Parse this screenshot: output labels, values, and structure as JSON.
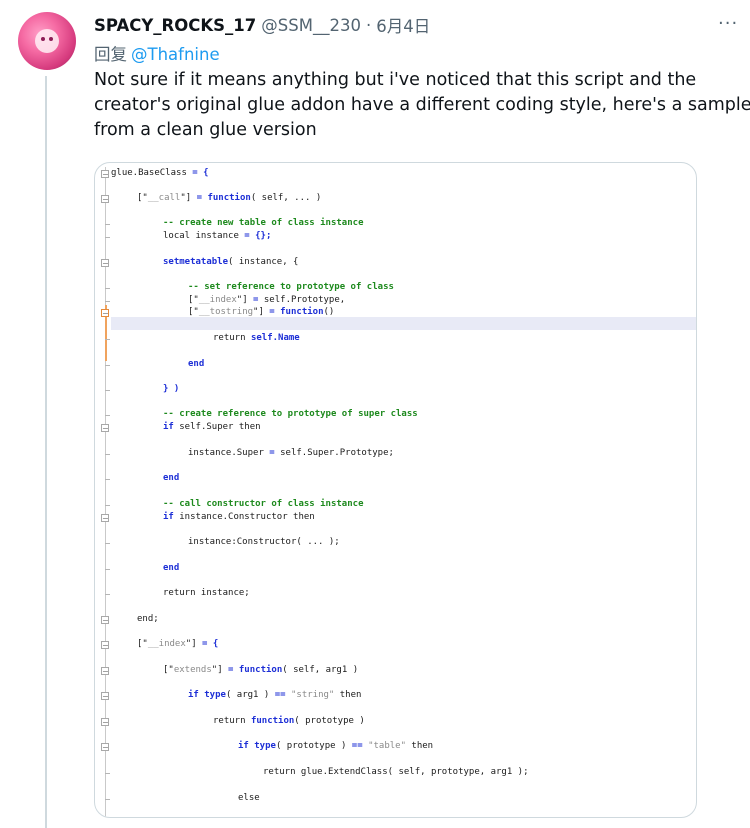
{
  "tweet": {
    "display_name": "SPACY_ROCKS_17",
    "handle": "@SSM__230",
    "separator": "·",
    "date": "6月4日",
    "more": "···",
    "reply_prefix": "回复",
    "reply_to": "@Thafnine",
    "text_lines": [
      "Not sure if it means anything but i've noticed that this script and the",
      "creator's original glue addon have a different coding style, here's a sample",
      "from a clean glue version"
    ]
  },
  "code_lines": [
    {
      "indent": 0,
      "parts": [
        [
          "t",
          "glue.BaseClass "
        ],
        [
          "o",
          "= {"
        ]
      ]
    },
    {
      "indent": 1,
      "parts": [
        [
          "t",
          "[\""
        ],
        [
          "s",
          "__call"
        ],
        [
          "t",
          "\"] "
        ],
        [
          "o",
          "= "
        ],
        [
          "k",
          "function"
        ],
        [
          "t",
          "( self, ... )"
        ]
      ]
    },
    {
      "indent": 2,
      "parts": [
        [
          "c",
          "-- create new table of class instance"
        ]
      ]
    },
    {
      "indent": 2,
      "parts": [
        [
          "t",
          "local instance "
        ],
        [
          "o",
          "= {};"
        ]
      ]
    },
    {
      "indent": 2,
      "parts": [
        [
          "k",
          "setmetatable"
        ],
        [
          "t",
          "( instance, {"
        ]
      ]
    },
    {
      "indent": 3,
      "parts": [
        [
          "c",
          "-- set reference to prototype of class"
        ]
      ]
    },
    {
      "indent": 3,
      "parts": [
        [
          "t",
          "[\""
        ],
        [
          "s",
          "__index"
        ],
        [
          "t",
          "\"] "
        ],
        [
          "o",
          "= "
        ],
        [
          "t",
          "self.Prototype,"
        ]
      ]
    },
    {
      "indent": 3,
      "parts": [
        [
          "t",
          "[\""
        ],
        [
          "s",
          "__tostring"
        ],
        [
          "t",
          "\"] "
        ],
        [
          "o",
          "= "
        ],
        [
          "k",
          "function"
        ],
        [
          "t",
          "()"
        ]
      ]
    },
    {
      "indent": 4,
      "parts": [
        [
          "t",
          "return "
        ],
        [
          "k",
          "self.Name"
        ]
      ]
    },
    {
      "indent": 3,
      "parts": [
        [
          "k",
          "end"
        ]
      ]
    },
    {
      "indent": 2,
      "parts": [
        [
          "o",
          "} )"
        ]
      ]
    },
    {
      "indent": 2,
      "parts": [
        [
          "c",
          "-- create reference to prototype of super class"
        ]
      ]
    },
    {
      "indent": 2,
      "parts": [
        [
          "k",
          "if "
        ],
        [
          "t",
          "self.Super then"
        ]
      ]
    },
    {
      "indent": 3,
      "parts": [
        [
          "t",
          "instance.Super "
        ],
        [
          "o",
          "= "
        ],
        [
          "t",
          "self.Super.Prototype;"
        ]
      ]
    },
    {
      "indent": 2,
      "parts": [
        [
          "k",
          "end"
        ]
      ]
    },
    {
      "indent": 2,
      "parts": [
        [
          "c",
          "-- call constructor of class instance"
        ]
      ]
    },
    {
      "indent": 2,
      "parts": [
        [
          "k",
          "if "
        ],
        [
          "t",
          "instance.Constructor then"
        ]
      ]
    },
    {
      "indent": 3,
      "parts": [
        [
          "t",
          "instance:Constructor( ... );"
        ]
      ]
    },
    {
      "indent": 2,
      "parts": [
        [
          "k",
          "end"
        ]
      ]
    },
    {
      "indent": 2,
      "parts": [
        [
          "t",
          "return instance;"
        ]
      ]
    },
    {
      "indent": 1,
      "parts": [
        [
          "t",
          "end;"
        ]
      ]
    },
    {
      "indent": 1,
      "parts": [
        [
          "t",
          "[\""
        ],
        [
          "s",
          "__index"
        ],
        [
          "t",
          "\"] "
        ],
        [
          "o",
          "= {"
        ]
      ]
    },
    {
      "indent": 2,
      "parts": [
        [
          "t",
          "[\""
        ],
        [
          "s",
          "extends"
        ],
        [
          "t",
          "\"] "
        ],
        [
          "o",
          "= "
        ],
        [
          "k",
          "function"
        ],
        [
          "t",
          "( self, arg1 )"
        ]
      ]
    },
    {
      "indent": 3,
      "parts": [
        [
          "k",
          "if type"
        ],
        [
          "t",
          "( arg1 ) "
        ],
        [
          "o",
          "== "
        ],
        [
          "s",
          "\"string\""
        ],
        [
          "t",
          " then"
        ]
      ]
    },
    {
      "indent": 4,
      "parts": [
        [
          "t",
          "return "
        ],
        [
          "k",
          "function"
        ],
        [
          "t",
          "( prototype )"
        ]
      ]
    },
    {
      "indent": 5,
      "parts": [
        [
          "k",
          "if type"
        ],
        [
          "t",
          "( prototype ) "
        ],
        [
          "o",
          "== "
        ],
        [
          "s",
          "\"table\""
        ],
        [
          "t",
          " then"
        ]
      ]
    },
    {
      "indent": 6,
      "parts": [
        [
          "t",
          "return glue.ExtendClass( self, prototype, arg1 );"
        ]
      ]
    },
    {
      "indent": 5,
      "parts": [
        [
          "t",
          "else"
        ]
      ]
    }
  ]
}
